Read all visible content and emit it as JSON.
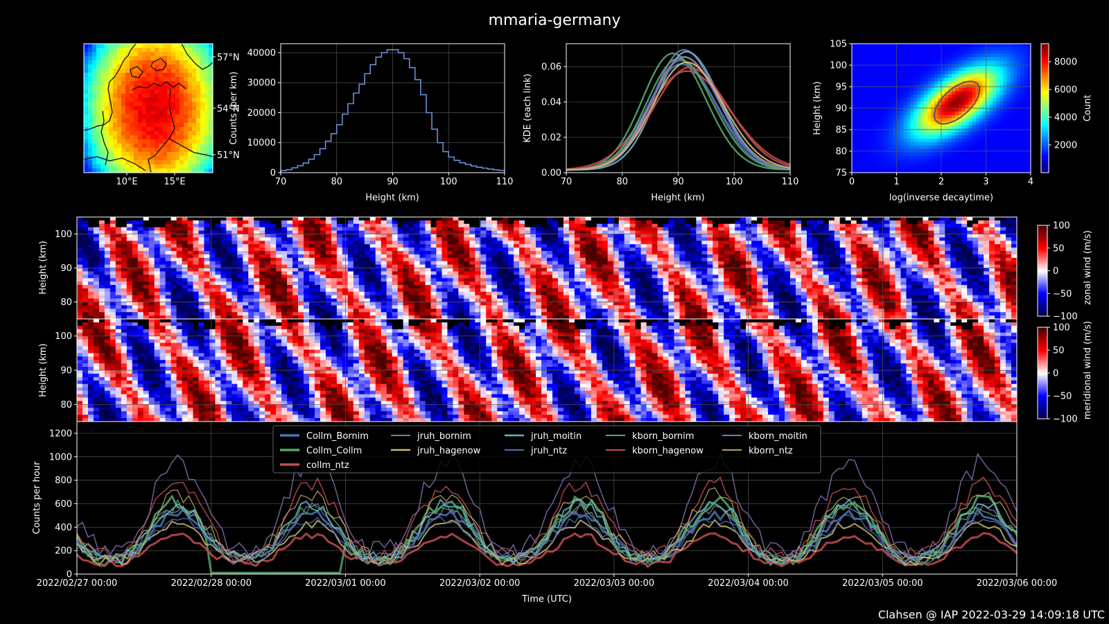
{
  "title": "mmaria-germany",
  "footer": "Clahsen @ IAP 2022-03-29 14:09:18 UTC",
  "colors": {
    "background": "#000000",
    "foreground": "#ffffff",
    "hist": "#6a8fd8"
  },
  "chart_data": [
    {
      "type": "heatmap",
      "name": "map",
      "subtype": "map",
      "lon_ticks": [
        "10°E",
        "15°E"
      ],
      "lat_ticks": [
        "57°N",
        "54°N",
        "51°N"
      ],
      "colormap": "jet"
    },
    {
      "type": "bar",
      "name": "height-histogram",
      "subtype": "step-histogram",
      "xlabel": "Height (km)",
      "ylabel": "Counts (per km)",
      "xlim": [
        70,
        110
      ],
      "ylim": [
        0,
        43000
      ],
      "xticks": [
        "70",
        "80",
        "90",
        "100",
        "110"
      ],
      "yticks": [
        "0",
        "10000",
        "20000",
        "30000",
        "40000"
      ],
      "x": [
        70,
        71,
        72,
        73,
        74,
        75,
        76,
        77,
        78,
        79,
        80,
        81,
        82,
        83,
        84,
        85,
        86,
        87,
        88,
        89,
        90,
        91,
        92,
        93,
        94,
        95,
        96,
        97,
        98,
        99,
        100,
        101,
        102,
        103,
        104,
        105,
        106,
        107,
        108,
        109
      ],
      "values": [
        700,
        1000,
        1600,
        2300,
        3200,
        4500,
        6000,
        8000,
        10500,
        13000,
        16000,
        19500,
        23000,
        26500,
        29500,
        33000,
        36000,
        38500,
        40000,
        41000,
        41000,
        40000,
        38000,
        35000,
        31000,
        26000,
        20000,
        14500,
        10000,
        7000,
        5200,
        4100,
        3300,
        2700,
        2200,
        1800,
        1500,
        1200,
        950,
        750
      ]
    },
    {
      "type": "line",
      "name": "kde-per-link",
      "xlabel": "Height (km)",
      "ylabel": "KDE (each link)",
      "xlim": [
        70,
        110
      ],
      "ylim": [
        0,
        0.073
      ],
      "xticks": [
        "70",
        "80",
        "90",
        "100",
        "110"
      ],
      "yticks": [
        "0.00",
        "0.02",
        "0.04",
        "0.06"
      ],
      "series": [
        {
          "name": "Collm_Bornim",
          "color": "#4c72b0",
          "peak": 90.5,
          "height": 0.062,
          "width": 5.6
        },
        {
          "name": "Collm_Collm",
          "color": "#55a868",
          "peak": 89.0,
          "height": 0.066,
          "width": 5.4
        },
        {
          "name": "collm_ntz",
          "color": "#c44e52",
          "peak": 91.5,
          "height": 0.056,
          "width": 7.0
        },
        {
          "name": "jruh_bornim",
          "color": "#8172b2",
          "peak": 91.0,
          "height": 0.068,
          "width": 5.5
        },
        {
          "name": "jruh_hagenow",
          "color": "#ccb974",
          "peak": 91.0,
          "height": 0.064,
          "width": 5.8
        },
        {
          "name": "jruh_moitin",
          "color": "#64b5cd",
          "peak": 91.5,
          "height": 0.067,
          "width": 5.4
        },
        {
          "name": "jruh_ntz",
          "color": "#4c72b0",
          "peak": 90.5,
          "height": 0.06,
          "width": 5.9
        },
        {
          "name": "kborn_bornim",
          "color": "#55a868",
          "peak": 90.0,
          "height": 0.063,
          "width": 5.6
        },
        {
          "name": "kborn_hagenow",
          "color": "#c44e52",
          "peak": 92.0,
          "height": 0.058,
          "width": 6.4
        },
        {
          "name": "kborn_moitin",
          "color": "#8172b2",
          "peak": 91.0,
          "height": 0.064,
          "width": 5.7
        },
        {
          "name": "kborn_ntz",
          "color": "#ccb974",
          "peak": 91.5,
          "height": 0.061,
          "width": 6.0
        }
      ]
    },
    {
      "type": "heatmap",
      "name": "decaytime-height-density",
      "xlabel": "log(inverse decaytime)",
      "ylabel": "Height (km)",
      "xlim": [
        0,
        4
      ],
      "ylim": [
        75,
        105
      ],
      "xticks": [
        "0",
        "1",
        "2",
        "3",
        "4"
      ],
      "yticks": [
        "75",
        "80",
        "85",
        "90",
        "95",
        "100",
        "105"
      ],
      "colorbar_label": "Count",
      "colorbar_ticks": [
        "2000",
        "4000",
        "6000",
        "8000"
      ],
      "colorbar_range": [
        0,
        9300
      ],
      "peak": {
        "x": 2.35,
        "y": 91.5,
        "count": 9300
      }
    },
    {
      "type": "heatmap",
      "name": "zonal-wind",
      "ylabel": "Height (km)",
      "yticks": [
        "80",
        "90",
        "100"
      ],
      "ylim": [
        75,
        105
      ],
      "colorbar_label": "zonal wind (m/s)",
      "colorbar_ticks": [
        "100",
        "50",
        "0",
        "−50",
        "−100"
      ],
      "colorbar_range": [
        -100,
        100
      ],
      "colormap": "seismic"
    },
    {
      "type": "heatmap",
      "name": "meridional-wind",
      "ylabel": "Height (km)",
      "yticks": [
        "80",
        "90",
        "100"
      ],
      "ylim": [
        75,
        105
      ],
      "colorbar_label": "meridional wind (m/s)",
      "colorbar_ticks": [
        "100",
        "50",
        "0",
        "−50",
        "−100"
      ],
      "colorbar_range": [
        -100,
        100
      ],
      "colormap": "seismic"
    },
    {
      "type": "line",
      "name": "counts-per-hour",
      "xlabel": "Time (UTC)",
      "ylabel": "Counts per hour",
      "ylim": [
        0,
        1300
      ],
      "yticks": [
        "0",
        "200",
        "400",
        "600",
        "800",
        "1000",
        "1200"
      ],
      "xticks": [
        "2022/02/27 00:00",
        "2022/02/28 00:00",
        "2022/03/01 00:00",
        "2022/03/02 00:00",
        "2022/03/03 00:00",
        "2022/03/04 00:00",
        "2022/03/05 00:00",
        "2022/03/06 00:00"
      ],
      "legend_position": "top-center",
      "series": [
        {
          "name": "Collm_Bornim",
          "color": "#4c72b0",
          "width": 3,
          "peak": 520,
          "min": 130
        },
        {
          "name": "Collm_Collm",
          "color": "#55a868",
          "width": 3,
          "peak": 620,
          "min": 120,
          "dropout": [
            "2022/02/28 00:00",
            "2022/03/01 00:00"
          ]
        },
        {
          "name": "collm_ntz",
          "color": "#c44e52",
          "width": 3,
          "peak": 330,
          "min": 90
        },
        {
          "name": "jruh_bornim",
          "color": "#8172b2",
          "width": 1.5,
          "peak": 560,
          "min": 140
        },
        {
          "name": "jruh_hagenow",
          "color": "#ccb974",
          "width": 2,
          "peak": 430,
          "min": 110
        },
        {
          "name": "jruh_moitin",
          "color": "#64b5cd",
          "width": 2,
          "peak": 600,
          "min": 140
        },
        {
          "name": "jruh_ntz",
          "color": "#4c72b0",
          "width": 1.5,
          "peak": 470,
          "min": 120
        },
        {
          "name": "kborn_bornim",
          "color": "#55a868",
          "width": 1.5,
          "peak": 580,
          "min": 130
        },
        {
          "name": "kborn_hagenow",
          "color": "#c44e52",
          "width": 1.5,
          "peak": 770,
          "min": 160
        },
        {
          "name": "kborn_moitin",
          "color": "#8172b2",
          "width": 1.5,
          "peak": 960,
          "min": 200
        },
        {
          "name": "kborn_ntz",
          "color": "#ccb974",
          "width": 1.2,
          "peak": 680,
          "min": 150
        }
      ]
    }
  ]
}
